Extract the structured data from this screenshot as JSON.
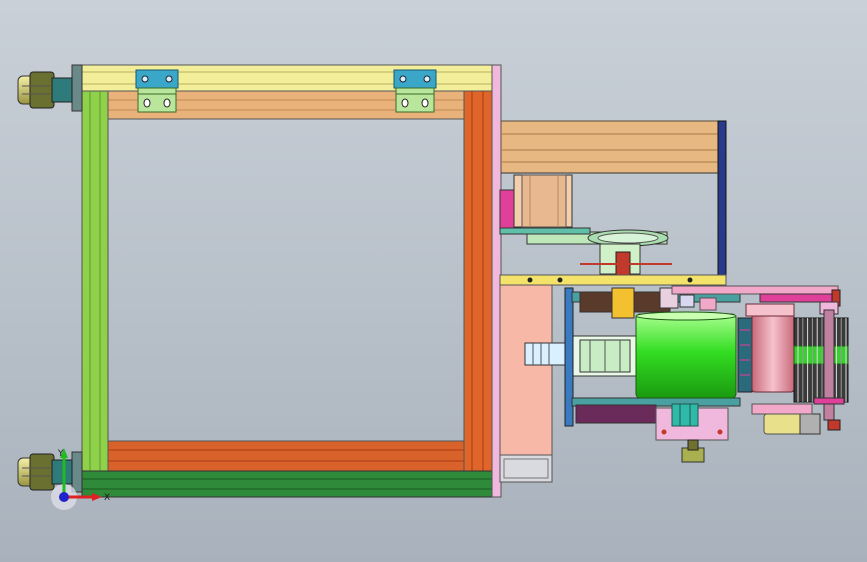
{
  "view": {
    "background_top": "#c9d0d8",
    "background_bottom": "#a9b2bc",
    "type": "cad-assembly-top-view"
  },
  "colors": {
    "frame_top_beam": "#f3ee9a",
    "frame_top_inner": "#e8b27a",
    "frame_left_beam": "#8fd14a",
    "frame_right_beam": "#e0652a",
    "frame_bottom_inner": "#d9622a",
    "frame_bottom_beam": "#2f8a3a",
    "end_plate": "#f0b8dc",
    "hinge": "#3aa7c9",
    "hinge_plate": "#b9e69a",
    "caster_yellow": "#e8e080",
    "caster_dark": "#8a8a3a",
    "box_beam": "#e8b882",
    "box_post": "#2a3a8a",
    "motor_green": "#33dd22",
    "roller_pink": "#e89aa8",
    "shelf_yellow": "#f3e36a",
    "magenta": "#e0409a",
    "plate_pink": "#f7b8a8",
    "dark_brown": "#5a3a2a",
    "cyan": "#4ac0d8"
  },
  "triad": {
    "y_label": "Y",
    "x_label": "X",
    "y_color": "#22bb22",
    "x_color": "#dd2222",
    "z_color": "#2222cc"
  }
}
